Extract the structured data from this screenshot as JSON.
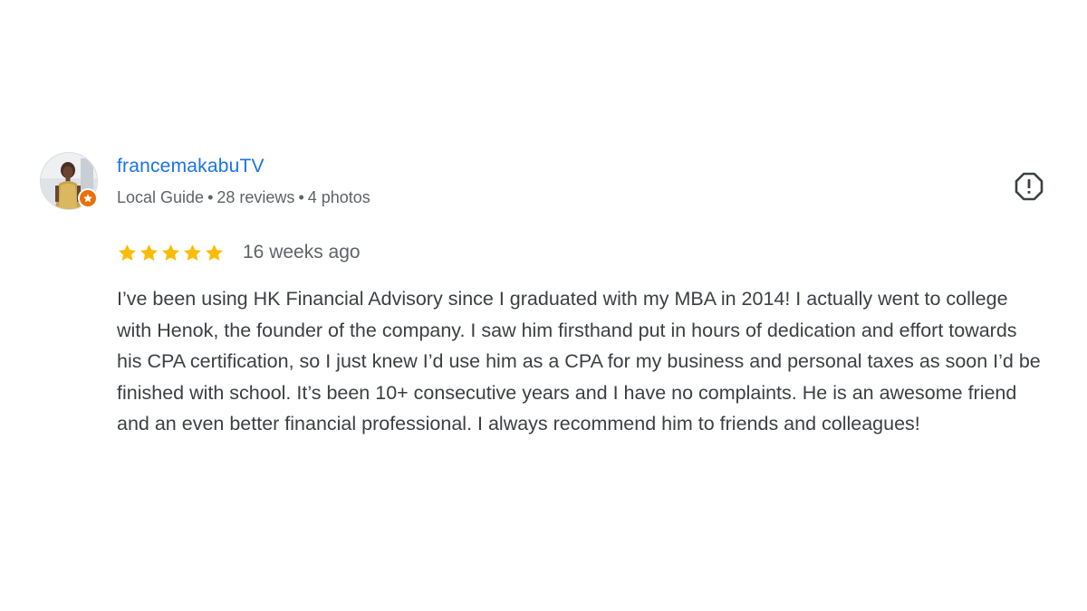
{
  "review": {
    "author": "francemakabuTV",
    "badge": "Local Guide",
    "separator": "•",
    "reviews_count": "28 reviews",
    "photos_count": "4 photos",
    "rating": 5,
    "rating_max": 5,
    "time": "16 weeks ago",
    "text": "I’ve been using HK Financial Advisory since I graduated with my MBA in 2014! I actually went to college with Henok, the founder of the company. I saw him firsthand put in hours of dedication and effort towards his CPA certification, so I just knew I’d use him as a CPA for my business and personal taxes as soon I’d be finished with school. It’s been 10+ consecutive years and I have no complaints. He is an awesome friend and an even better financial professional. I always recommend him to friends and colleagues!",
    "icons": {
      "avatar": "user-avatar",
      "guide_badge": "local-guide-star-icon",
      "report": "report-exclamation-icon",
      "star": "star-icon"
    },
    "colors": {
      "author": "#1a73e8",
      "star": "#fbbc04",
      "badge": "#e8710a",
      "meta": "#5f6368",
      "body_text": "#3c4043"
    }
  }
}
